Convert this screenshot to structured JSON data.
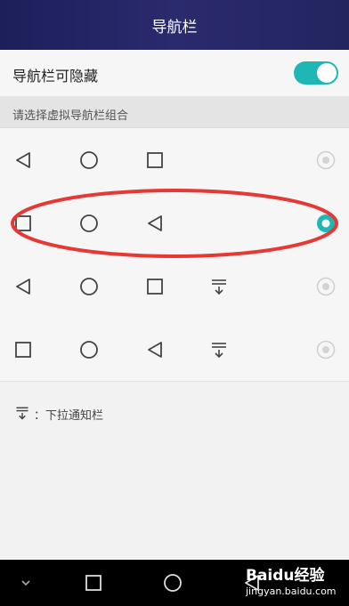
{
  "header": {
    "title": "导航栏"
  },
  "settings": {
    "hide_nav_label": "导航栏可隐藏",
    "hide_nav_enabled": true,
    "section_label": "请选择虚拟导航栏组合"
  },
  "options": [
    {
      "icons": [
        "back-icon",
        "home-icon",
        "recent-apps-icon"
      ],
      "selected": false
    },
    {
      "icons": [
        "recent-apps-icon",
        "home-icon",
        "back-icon"
      ],
      "selected": true
    },
    {
      "icons": [
        "back-icon",
        "home-icon",
        "recent-apps-icon",
        "notification-pull-down-icon"
      ],
      "selected": false
    },
    {
      "icons": [
        "recent-apps-icon",
        "home-icon",
        "back-icon",
        "notification-pull-down-icon"
      ],
      "selected": false
    }
  ],
  "legend": {
    "text": "：下拉通知栏",
    "icon": "notification-pull-down-icon"
  },
  "navbar": {
    "icons": [
      "collapse-icon",
      "recent-apps-icon",
      "home-icon",
      "back-icon"
    ]
  },
  "watermark": {
    "main": "Baidu经验",
    "sub": "jingyan.baidu.com"
  },
  "colors": {
    "accent": "#1fb6b6",
    "highlight": "#e53935",
    "titlebar": "#23255f"
  }
}
